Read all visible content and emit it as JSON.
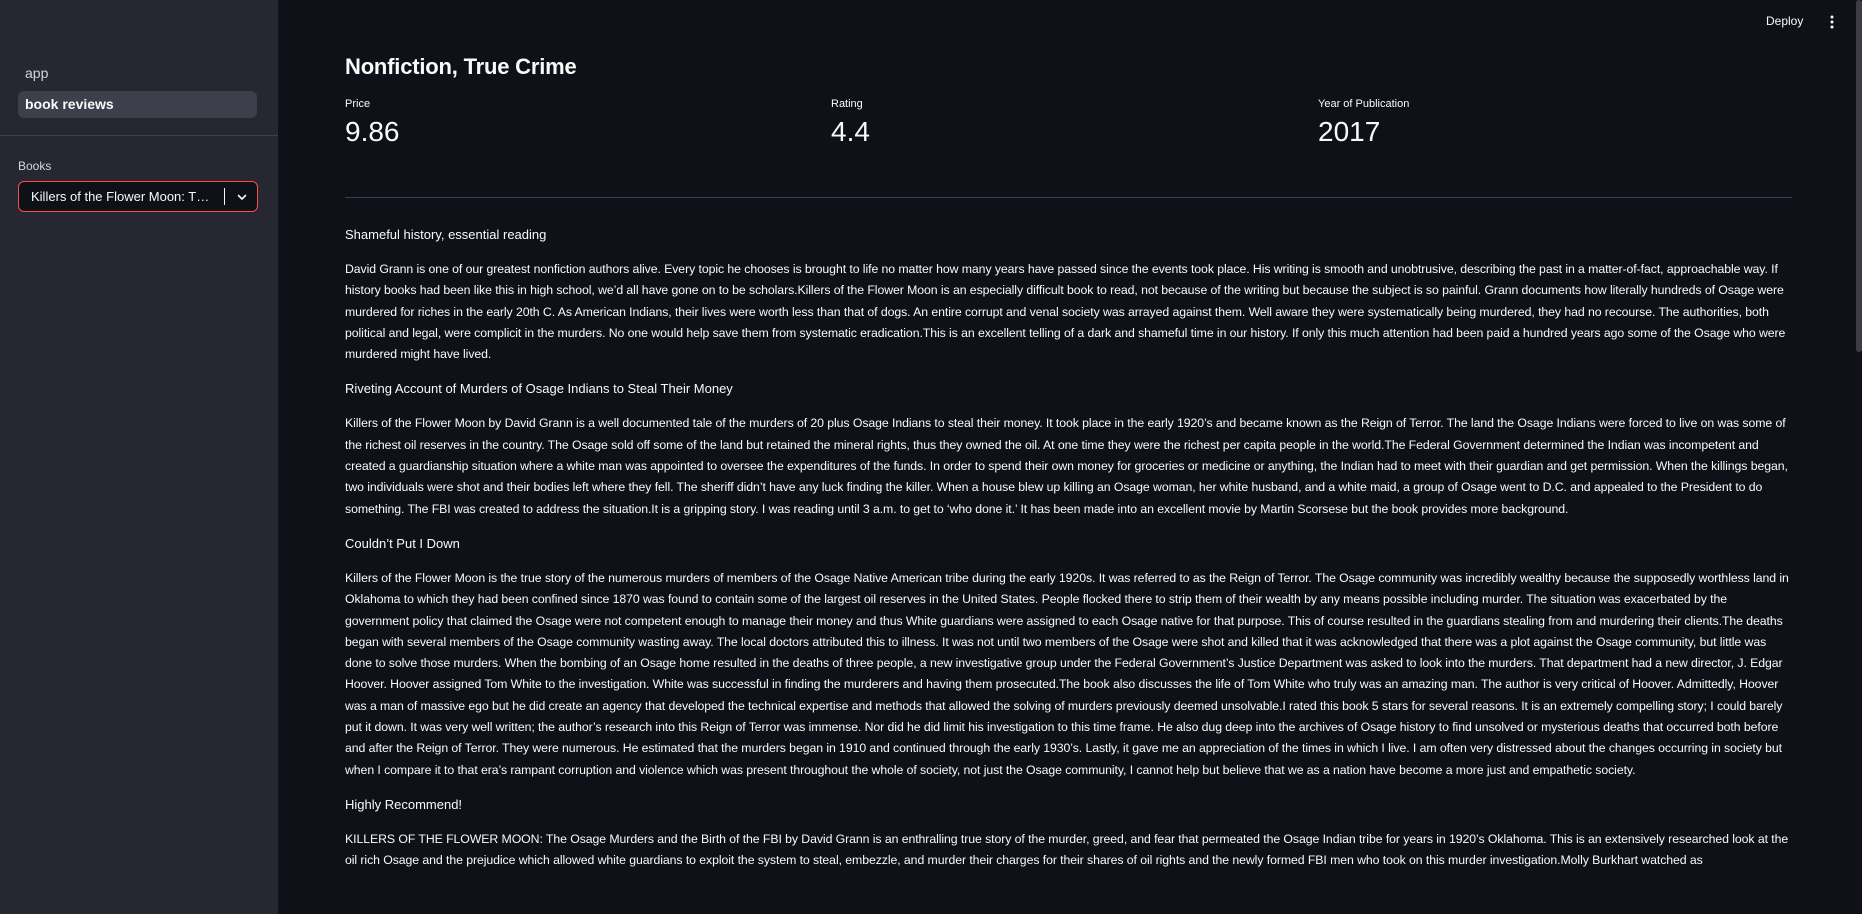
{
  "sidebar": {
    "nav": [
      {
        "label": "app",
        "active": false
      },
      {
        "label": "book reviews",
        "active": true
      }
    ],
    "select_label": "Books",
    "select_value": "Killers of the Flower Moon: The Osage Murders and the Birth of the FBI"
  },
  "topbar": {
    "deploy_label": "Deploy"
  },
  "main": {
    "title": "Nonfiction, True Crime",
    "metrics": [
      {
        "label": "Price",
        "value": "9.86"
      },
      {
        "label": "Rating",
        "value": "4.4"
      },
      {
        "label": "Year of Publication",
        "value": "2017"
      }
    ],
    "reviews": [
      {
        "title": "Shameful history, essential reading",
        "body": "David Grann is one of our greatest nonfiction authors alive. Every topic he chooses is brought to life no matter how many years have passed since the events took place. His writing is smooth and unobtrusive, describing the past in a matter-of-fact, approachable way. If history books had been like this in high school, we’d all have gone on to be scholars.Killers of the Flower Moon is an especially difficult book to read, not because of the writing but because the subject is so painful. Grann documents how literally hundreds of Osage were murdered for riches in the early 20th C. As American Indians, their lives were worth less than that of dogs. An entire corrupt and venal society was arrayed against them. Well aware they were systematically being murdered, they had no recourse. The authorities, both political and legal, were complicit in the murders. No one would help save them from systematic eradication.This is an excellent telling of a dark and shameful time in our history. If only this much attention had been paid a hundred years ago some of the Osage who were murdered might have lived."
      },
      {
        "title": "Riveting Account of Murders of Osage Indians to Steal Their Money",
        "body": "Killers of the Flower Moon by David Grann is a well documented tale of the murders of 20 plus Osage Indians to steal their money. It took place in the early 1920’s and became known as the Reign of Terror. The land the Osage Indians were forced to live on was some of the richest oil reserves in the country. The Osage sold off some of the land but retained the mineral rights, thus they owned the oil. At one time they were the richest per capita people in the world.The Federal Government determined the Indian was incompetent and created a guardianship situation where a white man was appointed to oversee the expenditures of the funds. In order to spend their own money for groceries or medicine or anything, the Indian had to meet with their guardian and get permission. When the killings began, two individuals were shot and their bodies left where they fell. The sheriff didn’t have any luck finding the killer. When a house blew up killing an Osage woman, her white husband, and a white maid, a group of Osage went to D.C. and appealed to the President to do something. The FBI was created to address the situation.It is a gripping story. I was reading until 3 a.m. to get to ‘who done it.’ It has been made into an excellent movie by Martin Scorsese but the book provides more background."
      },
      {
        "title": "Couldn’t Put I Down",
        "body": "Killers of the Flower Moon is the true story of the numerous murders of members of the Osage Native American tribe during the early 1920s. It was referred to as the Reign of Terror. The Osage community was incredibly wealthy because the supposedly worthless land in Oklahoma to which they had been confined since 1870 was found to contain some of the largest oil reserves in the United States. People flocked there to strip them of their wealth by any means possible including murder. The situation was exacerbated by the government policy that claimed the Osage were not competent enough to manage their money and thus White guardians were assigned to each Osage native for that purpose. This of course resulted in the guardians stealing from and murdering their clients.The deaths began with several members of the Osage community wasting away. The local doctors attributed this to illness. It was not until two members of the Osage were shot and killed that it was acknowledged that there was a plot against the Osage community, but little was done to solve those murders. When the bombing of an Osage home resulted in the deaths of three people, a new investigative group under the Federal Government’s Justice Department was asked to look into the murders. That department had a new director, J. Edgar Hoover. Hoover assigned Tom White to the investigation. White was successful in finding the murderers and having them prosecuted.The book also discusses the life of Tom White who truly was an amazing man. The author is very critical of Hoover. Admittedly, Hoover was a man of massive ego but he did create an agency that developed the technical expertise and methods that allowed the solving of murders previously deemed unsolvable.I rated this book 5 stars for several reasons. It is an extremely compelling story; I could barely put it down. It was very well written; the author’s research into this Reign of Terror was immense. Nor did he did limit his investigation to this time frame. He also dug deep into the archives of Osage history to find unsolved or mysterious deaths that occurred both before and after the Reign of Terror. They were numerous. He estimated that the murders began in 1910 and continued through the early 1930’s. Lastly, it gave me an appreciation of the times in which I live. I am often very distressed about the changes occurring in society but when I compare it to that era’s rampant corruption and violence which was present throughout the whole of society, not just the Osage community, I cannot help but believe that we as a nation have become a more just and empathetic society."
      },
      {
        "title": "Highly Recommend!",
        "body": "KILLERS OF THE FLOWER MOON: The Osage Murders and the Birth of the FBI by David Grann is an enthralling true story of the murder, greed, and fear that permeated the Osage Indian tribe for years in 1920’s Oklahoma. This is an extensively researched look at the oil rich Osage and the prejudice which allowed white guardians to exploit the system to steal, embezzle, and murder their charges for their shares of oil rights and the newly formed FBI men who took on this murder investigation.Molly Burkhart watched as"
      }
    ]
  },
  "colors": {
    "background": "#0e1117",
    "sidebar": "#262730",
    "accent": "#ff4b4b",
    "text": "#fafafa"
  }
}
